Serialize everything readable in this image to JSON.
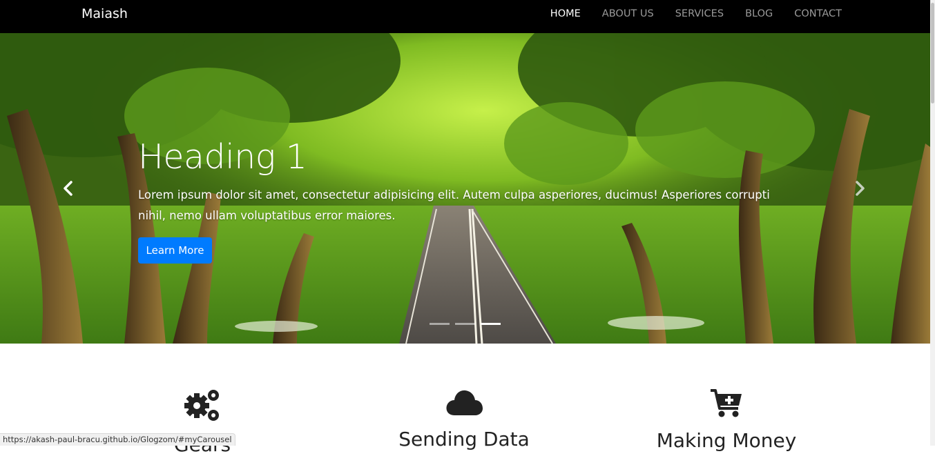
{
  "brand": "Maiash",
  "nav": [
    {
      "label": "HOME",
      "active": true
    },
    {
      "label": "ABOUT US",
      "active": false
    },
    {
      "label": "SERVICES",
      "active": false
    },
    {
      "label": "BLOG",
      "active": false
    },
    {
      "label": "CONTACT",
      "active": false
    }
  ],
  "carousel": {
    "heading": "Heading 1",
    "text": "Lorem ipsum dolor sit amet, consectetur adipisicing elit. Autem culpa asperiores, ducimus! Asperiores corrupti nihil, nemo ullam voluptatibus error maiores.",
    "button": "Learn More",
    "active_slide": 3,
    "slide_count": 3
  },
  "features": [
    {
      "icon": "gears-icon",
      "title": "Gears"
    },
    {
      "icon": "cloud-icon",
      "title": "Sending Data"
    },
    {
      "icon": "cart-plus-icon",
      "title": "Making Money"
    }
  ],
  "status_url": "https://akash-paul-bracu.github.io/Glogzom/#myCarousel",
  "colors": {
    "navbar": "#000000",
    "button": "#007bff"
  }
}
